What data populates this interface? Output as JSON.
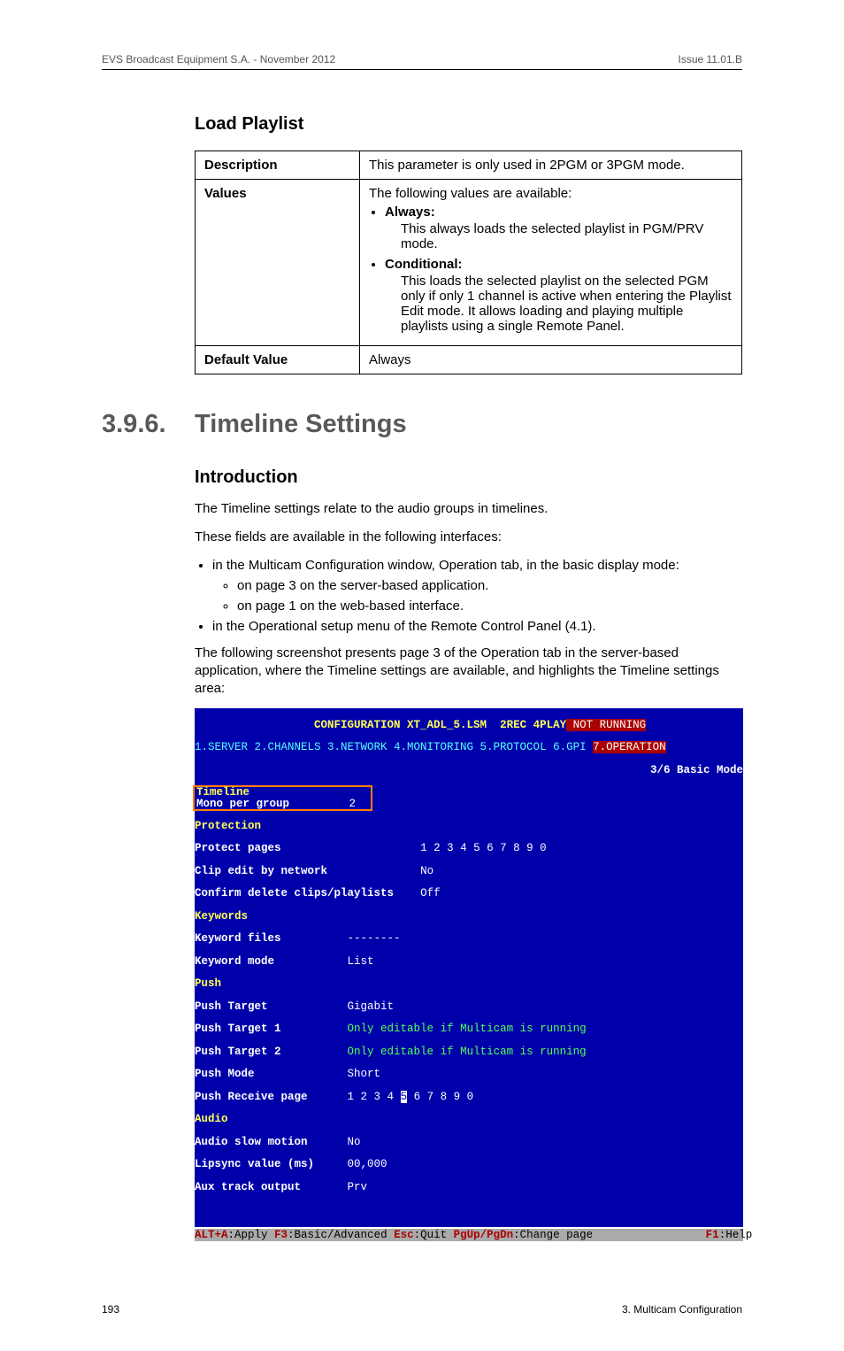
{
  "header": {
    "left": "EVS Broadcast Equipment S.A. - November 2012",
    "right": "Issue 11.01.B"
  },
  "load_playlist": {
    "title": "Load Playlist",
    "rows": {
      "description_label": "Description",
      "description_value": "This parameter is only used in 2PGM or 3PGM mode.",
      "values_label": "Values",
      "values_intro": "The following values are available:",
      "always_label": "Always:",
      "always_desc": "This always loads the selected playlist in PGM/PRV mode.",
      "conditional_label": "Conditional:",
      "conditional_desc": "This loads the selected playlist on the selected PGM only if only 1 channel is active when entering the Playlist Edit mode. It allows loading and playing multiple playlists using a single Remote Panel.",
      "default_label": "Default Value",
      "default_value": "Always"
    }
  },
  "section": {
    "number": "3.9.6.",
    "title": "Timeline Settings"
  },
  "intro": {
    "heading": "Introduction",
    "p1": "The Timeline settings relate to the audio groups in timelines.",
    "p2": "These fields are available in the following interfaces:",
    "li1": "in the Multicam Configuration window, Operation tab, in the basic display mode:",
    "li1a": "on page 3 on the server-based application.",
    "li1b": "on page 1 on the web-based interface.",
    "li2": "in the Operational setup menu of the Remote Control Panel (4.1).",
    "p3": "The following screenshot presents page 3 of the Operation tab in the server-based application, where the Timeline settings are available, and highlights the Timeline settings area:"
  },
  "terminal": {
    "title_left": "CONFIGURATION XT_ADL_5.LSM  2REC 4PLAY",
    "title_right": " NOT RUNNING",
    "tabs": "1.SERVER 2.CHANNELS 3.NETWORK 4.MONITORING 5.PROTOCOL 6.GPI ",
    "tab_active": "7.OPERATION",
    "mode_label": "3/6 Basic Mode",
    "timeline_header": "Timeline",
    "timeline_item_label": "Mono per group",
    "timeline_item_value": "2",
    "protection_header": "Protection",
    "protect_pages_label": "Protect pages",
    "protect_pages_value": "1 2 3 4 5 6 7 8 9 0",
    "clip_edit_label": "Clip edit by network",
    "clip_edit_value": "No",
    "confirm_delete_label": "Confirm delete clips/playlists",
    "confirm_delete_value": "Off",
    "keywords_header": "Keywords",
    "keyword_files_label": "Keyword files",
    "keyword_files_value": "--------",
    "keyword_mode_label": "Keyword mode",
    "keyword_mode_value": "List",
    "push_header": "Push",
    "push_target_label": "Push Target",
    "push_target_value": "Gigabit",
    "push_target1_label": "Push Target 1",
    "push_target1_value": "Only editable if Multicam is running",
    "push_target2_label": "Push Target 2",
    "push_target2_value": "Only editable if Multicam is running",
    "push_mode_label": "Push Mode",
    "push_mode_value": "Short",
    "push_receive_label": "Push Receive page",
    "push_receive_value_pre": "1 2 3 4 ",
    "push_receive_value_sel": "5",
    "push_receive_value_post": " 6 7 8 9 0",
    "audio_header": "Audio",
    "audio_slow_label": "Audio slow motion",
    "audio_slow_value": "No",
    "lipsync_label": "Lipsync value (ms)",
    "lipsync_value": "00,000",
    "aux_label": "Aux track output",
    "aux_value": "Prv",
    "footer_alt_a": "ALT+A",
    "footer_apply": ":Apply ",
    "footer_f3": "F3",
    "footer_basic": ":Basic/Advanced ",
    "footer_esc": "Esc",
    "footer_quit": ":Quit ",
    "footer_pg": "PgUp/PgDn",
    "footer_change": ":Change page",
    "footer_f1": "F1",
    "footer_help": ":Help"
  },
  "footer": {
    "left": "193",
    "right": "3. Multicam Configuration"
  }
}
